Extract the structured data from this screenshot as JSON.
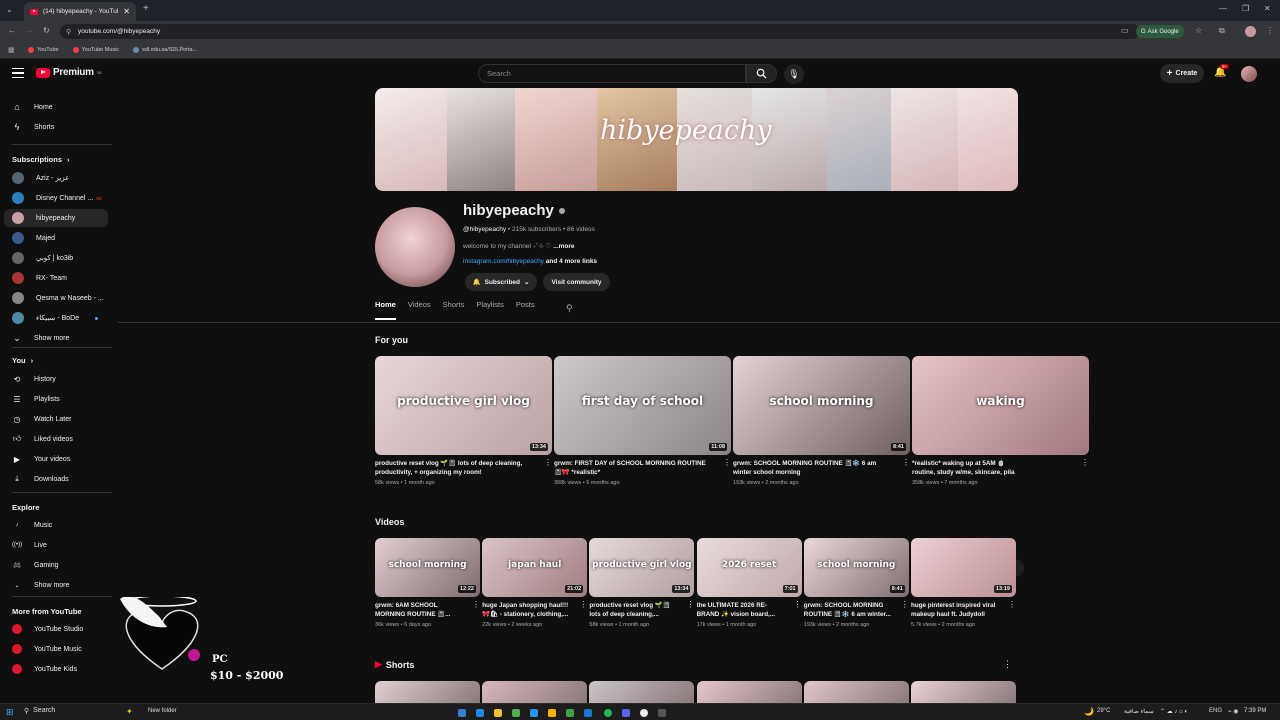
{
  "browser": {
    "tab_title": "(14) hibyepeachy - YouTube",
    "url": "youtube.com/@hibyepeachy",
    "ask_google": "Ask Google",
    "bookmarks": [
      "YouTube",
      "YouTube Music",
      "sdl.edu.sa/SDLPorta..."
    ]
  },
  "header": {
    "logo": "Premium",
    "logo_country": "SA",
    "search_placeholder": "Search",
    "create_label": "Create",
    "notification_count": "9+"
  },
  "sidebar": {
    "main": [
      {
        "label": "Home",
        "icon": "home-icon"
      },
      {
        "label": "Shorts",
        "icon": "shorts-icon"
      }
    ],
    "subscriptions_title": "Subscriptions",
    "subscriptions": [
      {
        "label": "Aziz - عزيز",
        "color": "#556677"
      },
      {
        "label": "Disney Channel ...",
        "color": "#2a7fbf"
      },
      {
        "label": "hibyepeachy",
        "color": "#c9a0a5"
      },
      {
        "label": "Majed",
        "color": "#3a5a8a"
      },
      {
        "label": "كوبي | ko3ib",
        "color": "#666666"
      },
      {
        "label": "RX- Team",
        "color": "#aa3333"
      },
      {
        "label": "Qesma w Naseeb - ...",
        "color": "#888888"
      },
      {
        "label": "سبيكاء - BoDe",
        "color": "#4a8aa8"
      }
    ],
    "show_more": "Show more",
    "you_title": "You",
    "you_items": [
      {
        "label": "History",
        "icon": "history-icon"
      },
      {
        "label": "Playlists",
        "icon": "playlists-icon"
      },
      {
        "label": "Watch Later",
        "icon": "watch-later-icon"
      },
      {
        "label": "Liked videos",
        "icon": "like-icon"
      },
      {
        "label": "Your videos",
        "icon": "your-videos-icon"
      },
      {
        "label": "Downloads",
        "icon": "download-icon"
      }
    ],
    "explore_title": "Explore",
    "explore_items": [
      {
        "label": "Music",
        "icon": "music-icon"
      },
      {
        "label": "Live",
        "icon": "live-icon"
      },
      {
        "label": "Gaming",
        "icon": "gaming-icon"
      },
      {
        "label": "Show more",
        "icon": "chevron-down-icon"
      }
    ],
    "more_title": "More from YouTube",
    "more_items": [
      "YouTube Studio",
      "YouTube Music",
      "YouTube Kids"
    ]
  },
  "channel": {
    "banner_text": "hibyepeachy",
    "name": "hibyepeachy",
    "handle": "@hibyepeachy",
    "subscribers": "215k subscribers",
    "videos": "86 videos",
    "description": "welcome to my channel ₊˚⊹ ♡",
    "more": "...more",
    "link": "instagram.com/hibyepeachy",
    "more_links": "and 4 more links",
    "subscribed_label": "Subscribed",
    "visit_label": "Visit community"
  },
  "tabs": [
    "Home",
    "Videos",
    "Shorts",
    "Playlists",
    "Posts"
  ],
  "for_you": {
    "title": "For you",
    "items": [
      {
        "thumb_text": "productive girl vlog",
        "duration": "13:34",
        "title": "productive reset vlog 🌱📓 lots of deep cleaning,\nproductivity, + organizing my room!",
        "meta": "58k views • 1 month ago",
        "colors": [
          "#e8d6d8",
          "#b9a2a4"
        ]
      },
      {
        "thumb_text": "first day of school",
        "duration": "11:08",
        "title": "grwm: FIRST DAY of SCHOOL MORNING ROUTINE\n📓🎀 *realistic*",
        "meta": "388k views • 5 months ago",
        "colors": [
          "#cfc9cb",
          "#8c8587"
        ]
      },
      {
        "thumb_text": "school morning",
        "duration": "8:41",
        "title": "grwm: SCHOOL MORNING ROUTINE 📓❄️ 6 am\nwinter school morning",
        "meta": "193k views • 2 months ago",
        "colors": [
          "#e4d2d4",
          "#6f5f61"
        ]
      },
      {
        "thumb_text": "waking",
        "duration": "",
        "title": "*realistic* waking up at 5AM 🍵\nroutine, study w/me, skincare, pila",
        "meta": "358k views • 7 months ago",
        "colors": [
          "#e7c4c8",
          "#a2787d"
        ]
      }
    ]
  },
  "videos": {
    "title": "Videos",
    "items": [
      {
        "thumb_text": "school morning",
        "duration": "12:22",
        "title": "grwm: 6AM SCHOOL\nMORNING ROUTINE 📓...",
        "meta": "36k views • 6 days ago",
        "colors": [
          "#e3cfd2",
          "#7d6b6e"
        ]
      },
      {
        "thumb_text": "japan haul",
        "duration": "21:02",
        "title": "huge Japan shopping haul!!!\n🎀🛍 - stationery, clothing,...",
        "meta": "22k views • 2 weeks ago",
        "colors": [
          "#d9c4c6",
          "#a07e82"
        ]
      },
      {
        "thumb_text": "productive girl vlog",
        "duration": "13:34",
        "title": "productive reset vlog 🌱📓\nlots of deep cleaning,...",
        "meta": "58k views • 1 month ago",
        "colors": [
          "#e6d8d9",
          "#b1a0a2"
        ]
      },
      {
        "thumb_text": "2026 reset",
        "duration": "7:01",
        "title": "the ULTIMATE 2026 RE-\nBRAND ✨ vision board,...",
        "meta": "17k views • 1 month ago",
        "colors": [
          "#e9dcdc",
          "#c0a9ab"
        ]
      },
      {
        "thumb_text": "school morning",
        "duration": "8:41",
        "title": "grwm: SCHOOL MORNING\nROUTINE 📓❄️ 6 am winter...",
        "meta": "193k views • 2 months ago",
        "colors": [
          "#ead7d9",
          "#806f72"
        ]
      },
      {
        "thumb_text": "",
        "duration": "13:19",
        "title": "huge pinterest inspired viral\nmakeup haul ft. Judydoll",
        "meta": "5.7k views • 2 months ago",
        "colors": [
          "#ecd0d4",
          "#b98e94"
        ]
      }
    ]
  },
  "shorts": {
    "title": "Shorts",
    "colors": [
      "#e0cfd1",
      "#d8b8bb",
      "#ccc4c6",
      "#e6c7cb",
      "#e0c6c9",
      "#e9d1d4"
    ]
  },
  "overlay": {
    "line1": "PC",
    "line2": "$10 - $2000"
  },
  "taskbar": {
    "search": "Search",
    "folder": "New folder",
    "weather": "29°C",
    "weather_desc": "سماء صافية",
    "lang": "ENG",
    "time": "7:39 PM"
  }
}
